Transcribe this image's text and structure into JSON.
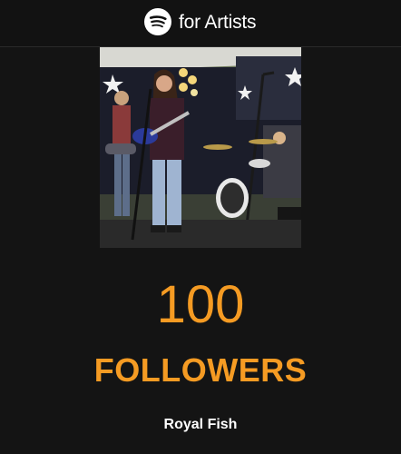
{
  "header": {
    "logo_icon": "spotify-logo-icon",
    "brand_text": "for Artists"
  },
  "milestone": {
    "photo_icon": "band-performance-photo",
    "count": "100",
    "label": "FOLLOWERS",
    "artist": "Royal Fish"
  },
  "colors": {
    "background": "#141414",
    "accent": "#f59b23",
    "text": "#ffffff"
  }
}
